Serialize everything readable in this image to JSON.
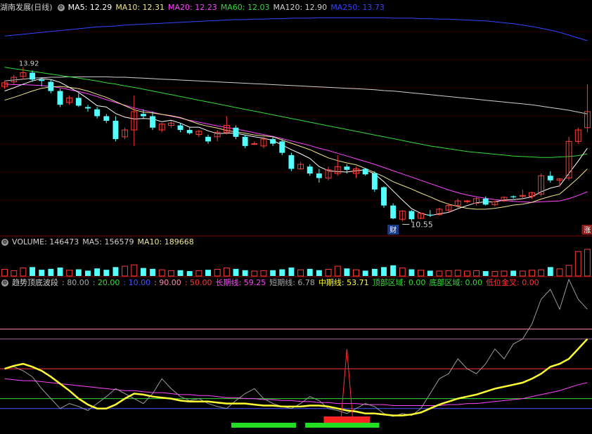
{
  "main_header": {
    "title": "湖南发展(日线)",
    "items": [
      {
        "label": "MA5: 12.29",
        "color": "#ffffff"
      },
      {
        "label": "MA10: 12.31",
        "color": "#f0e68c"
      },
      {
        "label": "MA20: 12.23",
        "color": "#ff44ff"
      },
      {
        "label": "MA60: 12.03",
        "color": "#33dd33"
      },
      {
        "label": "MA120: 12.90",
        "color": "#d0d0d0"
      },
      {
        "label": "MA250: 13.73",
        "color": "#3344ff"
      }
    ]
  },
  "vol_header": {
    "items": [
      {
        "label": "VOLUME: 146473",
        "color": "#d0d0d0"
      },
      {
        "label": "MA5: 156579",
        "color": "#d0d0d0"
      },
      {
        "label": "MA10: 189668",
        "color": "#f0e68c"
      }
    ]
  },
  "ind_header": {
    "title": "趋势顶底波段",
    "items": [
      {
        "label": ": 80.00",
        "color": "#aaaaaa"
      },
      {
        "label": ": 20.00",
        "color": "#33dd33"
      },
      {
        "label": ": 10.00",
        "color": "#4455ff"
      },
      {
        "label": ": 90.00",
        "color": "#ff88aa"
      },
      {
        "label": ": 50.00",
        "color": "#ff3333"
      },
      {
        "label": "长期线: 59.25",
        "color": "#ff44ff"
      },
      {
        "label": "短期线: 6.78",
        "color": "#aaaaaa"
      },
      {
        "label": "中期线: 53.71",
        "color": "#ffff33"
      },
      {
        "label": "顶部区域: 0.00",
        "color": "#33dd33"
      },
      {
        "label": "底部区域: 0.00",
        "color": "#33dd33"
      },
      {
        "label": "低位金叉: 0.00",
        "color": "#ff3333"
      }
    ]
  },
  "annotations": {
    "high_label": "13.92",
    "low_label": "10.55",
    "badge_cai": "财",
    "badge_zhang": "涨"
  },
  "chart_data": {
    "type": "candlestick",
    "ma_colors": {
      "ma5": "#ffffff",
      "ma10": "#f0e68c",
      "ma20": "#ff44ff",
      "ma60": "#33dd33",
      "ma120": "#d0d0d0",
      "ma250": "#3344ff"
    },
    "ohlc": [
      [
        13.5,
        13.62,
        13.45,
        13.58
      ],
      [
        13.6,
        13.75,
        13.55,
        13.7
      ],
      [
        13.72,
        13.92,
        13.65,
        13.8
      ],
      [
        13.8,
        13.85,
        13.6,
        13.65
      ],
      [
        13.65,
        13.7,
        13.5,
        13.62
      ],
      [
        13.6,
        13.65,
        13.35,
        13.4
      ],
      [
        13.4,
        13.45,
        13.05,
        13.1
      ],
      [
        13.15,
        13.3,
        13.1,
        13.25
      ],
      [
        13.25,
        13.35,
        13.05,
        13.08
      ],
      [
        13.05,
        13.1,
        12.95,
        13.02
      ],
      [
        13.0,
        13.05,
        12.8,
        12.85
      ],
      [
        12.85,
        12.9,
        12.7,
        12.75
      ],
      [
        12.75,
        12.85,
        12.3,
        12.35
      ],
      [
        12.4,
        12.6,
        12.35,
        12.55
      ],
      [
        12.55,
        13.3,
        12.2,
        12.95
      ],
      [
        12.9,
        13.0,
        12.8,
        12.85
      ],
      [
        12.85,
        12.95,
        12.55,
        12.6
      ],
      [
        12.55,
        12.7,
        12.5,
        12.68
      ],
      [
        12.65,
        12.75,
        12.6,
        12.7
      ],
      [
        12.65,
        12.7,
        12.5,
        12.55
      ],
      [
        12.55,
        12.6,
        12.45,
        12.48
      ],
      [
        12.45,
        12.55,
        12.4,
        12.52
      ],
      [
        12.4,
        12.45,
        12.25,
        12.3
      ],
      [
        12.4,
        12.55,
        12.3,
        12.5
      ],
      [
        12.5,
        12.85,
        12.45,
        12.65
      ],
      [
        12.6,
        12.65,
        12.35,
        12.4
      ],
      [
        12.4,
        12.45,
        12.15,
        12.2
      ],
      [
        12.25,
        12.3,
        12.22,
        12.25
      ],
      [
        12.2,
        12.4,
        12.15,
        12.35
      ],
      [
        12.35,
        12.4,
        12.2,
        12.25
      ],
      [
        12.3,
        12.35,
        12.0,
        12.05
      ],
      [
        12.0,
        12.05,
        11.65,
        11.7
      ],
      [
        11.7,
        11.85,
        11.68,
        11.8
      ],
      [
        11.75,
        11.8,
        11.55,
        11.6
      ],
      [
        11.6,
        11.7,
        11.4,
        11.5
      ],
      [
        11.5,
        11.75,
        11.45,
        11.68
      ],
      [
        11.6,
        12.0,
        11.55,
        11.75
      ],
      [
        11.75,
        11.8,
        11.6,
        11.68
      ],
      [
        11.6,
        11.75,
        11.5,
        11.7
      ],
      [
        11.7,
        11.72,
        11.55,
        11.58
      ],
      [
        11.6,
        11.65,
        11.2,
        11.25
      ],
      [
        11.3,
        11.32,
        10.85,
        10.9
      ],
      [
        10.9,
        10.95,
        10.6,
        10.62
      ],
      [
        10.6,
        10.8,
        10.55,
        10.78
      ],
      [
        10.78,
        10.8,
        10.55,
        10.6
      ],
      [
        10.62,
        10.75,
        10.6,
        10.73
      ],
      [
        10.7,
        10.8,
        10.65,
        10.68
      ],
      [
        10.7,
        10.85,
        10.68,
        10.82
      ],
      [
        10.8,
        10.95,
        10.75,
        10.9
      ],
      [
        10.9,
        11.05,
        10.85,
        11.0
      ],
      [
        11.0,
        11.02,
        10.95,
        11.0
      ],
      [
        10.95,
        11.1,
        10.9,
        11.05
      ],
      [
        11.05,
        11.1,
        10.9,
        10.92
      ],
      [
        10.92,
        11.0,
        10.88,
        10.98
      ],
      [
        11.0,
        11.1,
        10.98,
        11.08
      ],
      [
        11.1,
        11.12,
        11.05,
        11.08
      ],
      [
        11.1,
        11.25,
        11.05,
        11.12
      ],
      [
        11.1,
        11.2,
        11.05,
        11.18
      ],
      [
        11.15,
        11.6,
        11.1,
        11.55
      ],
      [
        11.55,
        11.65,
        11.4,
        11.45
      ],
      [
        11.45,
        11.5,
        11.3,
        11.48
      ],
      [
        11.5,
        12.4,
        11.45,
        12.3
      ],
      [
        12.3,
        12.6,
        12.25,
        12.55
      ],
      [
        12.6,
        13.55,
        12.5,
        12.95
      ]
    ],
    "ma5": [
      13.4,
      13.47,
      13.55,
      13.62,
      13.67,
      13.65,
      13.59,
      13.48,
      13.37,
      13.23,
      13.08,
      13.05,
      12.91,
      12.83,
      12.79,
      12.8,
      12.79,
      12.73,
      12.76,
      12.7,
      12.61,
      12.61,
      12.53,
      12.47,
      12.48,
      12.48,
      12.44,
      12.4,
      12.37,
      12.32,
      12.22,
      12.12,
      12.03,
      11.93,
      11.75,
      11.66,
      11.64,
      11.63,
      11.66,
      11.68,
      11.59,
      11.42,
      11.22,
      11.02,
      10.83,
      10.73,
      10.68,
      10.72,
      10.75,
      10.83,
      10.9,
      10.96,
      10.98,
      10.98,
      11.02,
      11.03,
      11.05,
      11.09,
      11.2,
      11.28,
      11.33,
      11.6,
      11.87,
      12.15
    ],
    "ma10": [
      13.2,
      13.26,
      13.33,
      13.4,
      13.46,
      13.49,
      13.5,
      13.48,
      13.45,
      13.4,
      13.33,
      13.26,
      13.17,
      13.08,
      12.99,
      12.94,
      12.92,
      12.89,
      12.86,
      12.82,
      12.75,
      12.68,
      12.63,
      12.59,
      12.54,
      12.51,
      12.48,
      12.44,
      12.42,
      12.4,
      12.33,
      12.26,
      12.19,
      12.12,
      12.03,
      11.94,
      11.88,
      11.83,
      11.79,
      11.71,
      11.62,
      11.53,
      11.42,
      11.34,
      11.26,
      11.17,
      11.09,
      11.0,
      10.93,
      10.88,
      10.84,
      10.82,
      10.82,
      10.84,
      10.87,
      10.91,
      10.93,
      10.97,
      11.04,
      11.1,
      11.15,
      11.32,
      11.5,
      11.7
    ],
    "ma20": [
      13.55,
      13.54,
      13.54,
      13.53,
      13.52,
      13.5,
      13.47,
      13.43,
      13.39,
      13.34,
      13.28,
      13.21,
      13.15,
      13.09,
      13.03,
      12.98,
      12.94,
      12.89,
      12.85,
      12.81,
      12.76,
      12.72,
      12.68,
      12.64,
      12.6,
      12.57,
      12.53,
      12.49,
      12.45,
      12.41,
      12.36,
      12.31,
      12.26,
      12.21,
      12.15,
      12.1,
      12.04,
      11.98,
      11.92,
      11.86,
      11.8,
      11.73,
      11.66,
      11.59,
      11.52,
      11.45,
      11.38,
      11.31,
      11.24,
      11.18,
      11.13,
      11.09,
      11.06,
      11.03,
      11.01,
      10.99,
      10.98,
      10.97,
      10.98,
      10.99,
      11.0,
      11.05,
      11.12,
      11.2
    ],
    "ma60": [
      13.92,
      13.89,
      13.86,
      13.83,
      13.8,
      13.77,
      13.74,
      13.71,
      13.68,
      13.65,
      13.62,
      13.58,
      13.55,
      13.51,
      13.48,
      13.44,
      13.4,
      13.36,
      13.32,
      13.28,
      13.24,
      13.2,
      13.16,
      13.12,
      13.08,
      13.04,
      13.0,
      12.96,
      12.92,
      12.88,
      12.84,
      12.8,
      12.76,
      12.72,
      12.68,
      12.64,
      12.6,
      12.56,
      12.52,
      12.48,
      12.44,
      12.4,
      12.36,
      12.32,
      12.28,
      12.24,
      12.2,
      12.17,
      12.14,
      12.11,
      12.08,
      12.06,
      12.04,
      12.02,
      12.0,
      11.98,
      11.97,
      11.96,
      11.95,
      11.95,
      11.96,
      11.97,
      11.99,
      12.03
    ],
    "ma120": [
      13.62,
      13.64,
      13.66,
      13.68,
      13.69,
      13.7,
      13.7,
      13.71,
      13.71,
      13.71,
      13.71,
      13.71,
      13.7,
      13.7,
      13.69,
      13.68,
      13.67,
      13.66,
      13.65,
      13.64,
      13.63,
      13.62,
      13.61,
      13.6,
      13.59,
      13.58,
      13.57,
      13.56,
      13.55,
      13.54,
      13.53,
      13.52,
      13.51,
      13.5,
      13.49,
      13.48,
      13.47,
      13.46,
      13.45,
      13.44,
      13.43,
      13.41,
      13.4,
      13.38,
      13.36,
      13.34,
      13.32,
      13.3,
      13.28,
      13.26,
      13.24,
      13.22,
      13.2,
      13.18,
      13.16,
      13.14,
      13.12,
      13.1,
      13.07,
      13.04,
      13.01,
      12.98,
      12.94,
      12.9
    ],
    "ma250": [
      14.6,
      14.62,
      14.64,
      14.66,
      14.68,
      14.7,
      14.72,
      14.74,
      14.76,
      14.78,
      14.8,
      14.81,
      14.82,
      14.84,
      14.85,
      14.86,
      14.87,
      14.88,
      14.89,
      14.9,
      14.91,
      14.92,
      14.93,
      14.94,
      14.95,
      14.96,
      14.96,
      14.97,
      14.97,
      14.98,
      14.98,
      14.99,
      14.99,
      14.99,
      15.0,
      15.0,
      15.0,
      15.0,
      15.0,
      15.0,
      15.0,
      15.0,
      14.99,
      14.99,
      14.99,
      14.98,
      14.98,
      14.97,
      14.97,
      14.96,
      14.95,
      14.94,
      14.93,
      14.91,
      14.89,
      14.87,
      14.84,
      14.81,
      14.77,
      14.73,
      14.68,
      14.62,
      14.56,
      14.5
    ],
    "volume": [
      15,
      12,
      18,
      20,
      14,
      16,
      19,
      13,
      15,
      12,
      17,
      14,
      20,
      22,
      25,
      18,
      16,
      14,
      12,
      13,
      11,
      12,
      14,
      15,
      18,
      16,
      13,
      11,
      12,
      13,
      15,
      19,
      14,
      16,
      13,
      15,
      22,
      17,
      14,
      12,
      16,
      20,
      24,
      18,
      15,
      13,
      12,
      11,
      12,
      13,
      11,
      12,
      11,
      10,
      11,
      12,
      11,
      13,
      14,
      20,
      16,
      24,
      55,
      60
    ],
    "volume_scale": 60,
    "osc_long": [
      40,
      39,
      38,
      38,
      37,
      36,
      35,
      34,
      33,
      32,
      31,
      30,
      29,
      28,
      28,
      27,
      26,
      26,
      25,
      24,
      24,
      23,
      23,
      22,
      21,
      21,
      20,
      20,
      19,
      19,
      18,
      18,
      17,
      17,
      16,
      16,
      15,
      15,
      15,
      14,
      14,
      14,
      13,
      13,
      13,
      13,
      13,
      13,
      14,
      14,
      15,
      15,
      16,
      17,
      18,
      19,
      20,
      22,
      24,
      26,
      28,
      31,
      34,
      36
    ],
    "osc_short": [
      50,
      52,
      48,
      42,
      30,
      20,
      10,
      15,
      12,
      8,
      15,
      22,
      30,
      25,
      20,
      15,
      25,
      40,
      30,
      22,
      18,
      20,
      15,
      12,
      10,
      18,
      25,
      30,
      20,
      15,
      12,
      10,
      15,
      22,
      18,
      10,
      8,
      5,
      10,
      15,
      12,
      5,
      2,
      5,
      3,
      10,
      25,
      40,
      45,
      60,
      50,
      45,
      55,
      70,
      60,
      75,
      80,
      95,
      120,
      130,
      110,
      140,
      120,
      110
    ],
    "osc_mid": [
      50,
      53,
      55,
      52,
      48,
      42,
      35,
      28,
      20,
      14,
      10,
      10,
      14,
      20,
      25,
      24,
      22,
      21,
      20,
      18,
      17,
      17,
      17,
      16,
      15,
      15,
      15,
      14,
      13,
      13,
      12,
      12,
      12,
      13,
      13,
      12,
      10,
      8,
      7,
      5,
      5,
      4,
      3,
      3,
      4,
      6,
      10,
      14,
      17,
      20,
      22,
      24,
      27,
      30,
      32,
      34,
      36,
      40,
      45,
      52,
      55,
      60,
      70,
      80
    ],
    "osc_levels": {
      "80": 80,
      "20": 20,
      "10": 10,
      "90": 90,
      "50": 50
    },
    "osc_scale": [
      -10,
      130
    ],
    "top_zone": [],
    "bottom_zone": [
      [
        25,
        31
      ],
      [
        33,
        40
      ]
    ],
    "golden_cross": [
      [
        35,
        39
      ]
    ],
    "golden_spike": 37
  }
}
